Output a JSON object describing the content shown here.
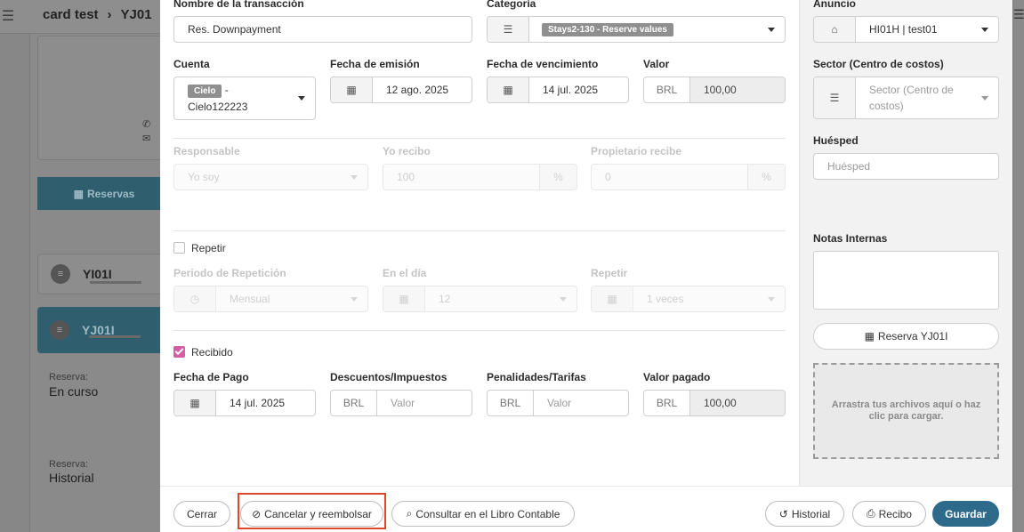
{
  "background": {
    "breadcrumb": {
      "root": "card test",
      "separator": "›",
      "current": "YJ01"
    },
    "reservas_label": "Reservas",
    "items": [
      {
        "code": "YI01I"
      },
      {
        "code": "YJ01I"
      }
    ],
    "reserva_label_1": "Reserva:",
    "reserva_value_1": "En curso",
    "reserva_label_2": "Reserva:",
    "reserva_value_2": "Historial"
  },
  "form": {
    "nombre_label": "Nombre de la transacción",
    "nombre_value": "Res. Downpayment",
    "categoria_label": "Categoría",
    "categoria_value": "Stays2-130 - Reserve values",
    "cuenta_label": "Cuenta",
    "cuenta_badge": "Cielo",
    "cuenta_sep": "-",
    "cuenta_value": "Cielo122223",
    "emision_label": "Fecha de emisión",
    "emision_value": "12 ago. 2025",
    "vencimiento_label": "Fecha de vencimiento",
    "vencimiento_value": "14 jul. 2025",
    "valor_label": "Valor",
    "valor_currency": "BRL",
    "valor_value": "100,00",
    "responsable_label": "Responsable",
    "responsable_value": "Yo soy",
    "yo_recibo_label": "Yo recibo",
    "yo_recibo_value": "100",
    "yo_recibo_unit": "%",
    "propietario_label": "Propietario recibe",
    "propietario_value": "0",
    "propietario_unit": "%",
    "repetir_check_label": "Repetir",
    "periodo_label": "Periodo de Repetición",
    "periodo_value": "Mensual",
    "en_el_dia_label": "En el día",
    "en_el_dia_value": "12",
    "repetir_label": "Repetir",
    "repetir_value": "1 veces",
    "recibido_label": "Recibido",
    "fecha_pago_label": "Fecha de Pago",
    "fecha_pago_value": "14 jul. 2025",
    "descuentos_label": "Descuentos/Impuestos",
    "descuentos_currency": "BRL",
    "descuentos_placeholder": "Valor",
    "penalidades_label": "Penalidades/Tarifas",
    "penalidades_currency": "BRL",
    "penalidades_placeholder": "Valor",
    "valor_pagado_label": "Valor pagado",
    "valor_pagado_currency": "BRL",
    "valor_pagado_value": "100,00"
  },
  "side": {
    "anuncio_label": "Anuncio",
    "anuncio_value": "HI01H | test01",
    "sector_label": "Sector (Centro de costos)",
    "sector_placeholder": "Sector (Centro de costos)",
    "huesped_label": "Huésped",
    "huesped_placeholder": "Huésped",
    "notas_label": "Notas Internas",
    "reserva_button": "Reserva YJ01I",
    "dropzone_text": "Arrastra tus archivos aquí o haz clic para cargar."
  },
  "footer": {
    "cerrar": "Cerrar",
    "cancelar": "Cancelar y reembolsar",
    "consultar": "Consultar en el Libro Contable",
    "historial": "Historial",
    "recibo": "Recibo",
    "guardar": "Guardar"
  },
  "colors": {
    "primary": "#2e6a8a",
    "checkbox_on": "#d65da4",
    "highlight": "#e0452e"
  }
}
